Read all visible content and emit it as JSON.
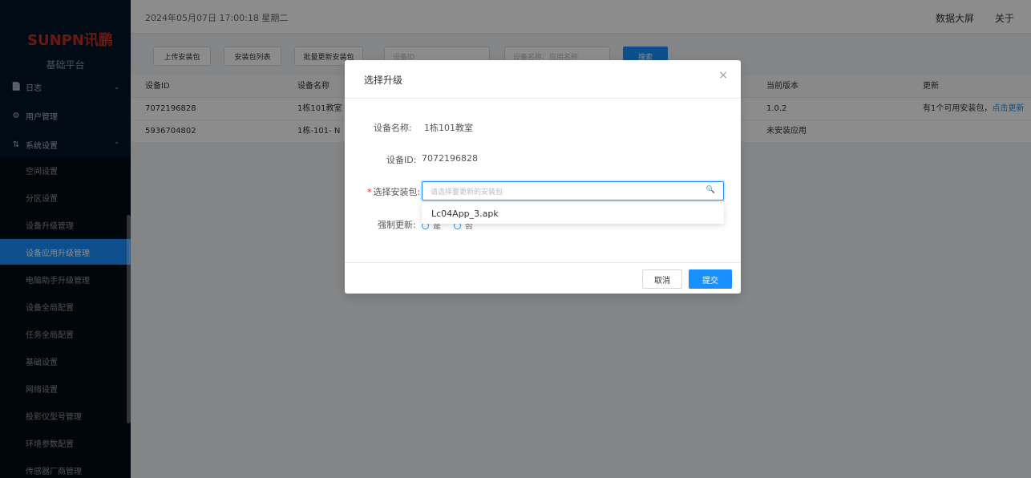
{
  "sidebar": {
    "logo_text_en": "SUNPN",
    "logo_text_cn": "讯鹏",
    "platform_name": "基础平台",
    "menu": [
      {
        "icon": "📄",
        "label": "日志",
        "arrow": "⌄"
      },
      {
        "icon": "⚙",
        "label": "用户管理",
        "arrow": ""
      },
      {
        "icon": "⇅",
        "label": "系统设置",
        "arrow": "⌃"
      }
    ],
    "sub_items": [
      "空间设置",
      "分区设置",
      "设备升级管理",
      "设备应用升级管理",
      "电脑助手升级管理",
      "设备全局配置",
      "任务全局配置",
      "基础设置",
      "网络设置",
      "投影仪型号管理",
      "环境参数配置",
      "传感器厂商管理"
    ],
    "active_sub_index": 3
  },
  "header": {
    "datetime": "2024年05月07日 17:00:18 星期二",
    "data_screen": "数据大屏",
    "about": "关于"
  },
  "toolbar": {
    "upload_button": "上传安装包",
    "package_list_button": "安装包列表",
    "batch_update_button": "批量更新安装包",
    "device_id_placeholder": "设备ID",
    "device_name_placeholder": "设备名称、应用名称",
    "search_button": "搜索"
  },
  "table": {
    "columns": [
      "设备ID",
      "设备名称",
      "当前版本",
      "更新"
    ],
    "rows": [
      {
        "device_id": "7072196828",
        "device_name": "1栋101教室",
        "version": "1.0.2",
        "update_text": "有1个可用安装包，",
        "update_link": "点击更新"
      },
      {
        "device_id": "5936704802",
        "device_name": "1栋-101- N",
        "version": "未安装应用",
        "update_text": "",
        "update_link": ""
      }
    ]
  },
  "modal": {
    "title": "选择升级",
    "close_icon": "×",
    "device_name_label": "设备名称:",
    "device_name_value": "1栋101教室",
    "device_id_label": "设备ID:",
    "device_id_value": "7072196828",
    "required_mark": "*",
    "package_label": "选择安装包:",
    "package_placeholder": "请选择要更新的安装包",
    "search_icon": "🔍",
    "dropdown_option": "Lc04App_3.apk",
    "force_update_label": "强制更新:",
    "radio_frag_1": "是",
    "radio_frag_2": "否",
    "cancel_button": "取消",
    "submit_button": "提交"
  },
  "colors": {
    "sidebar_bg": "#001529",
    "active": "#1890ff",
    "brand_red": "#c22e1f"
  }
}
